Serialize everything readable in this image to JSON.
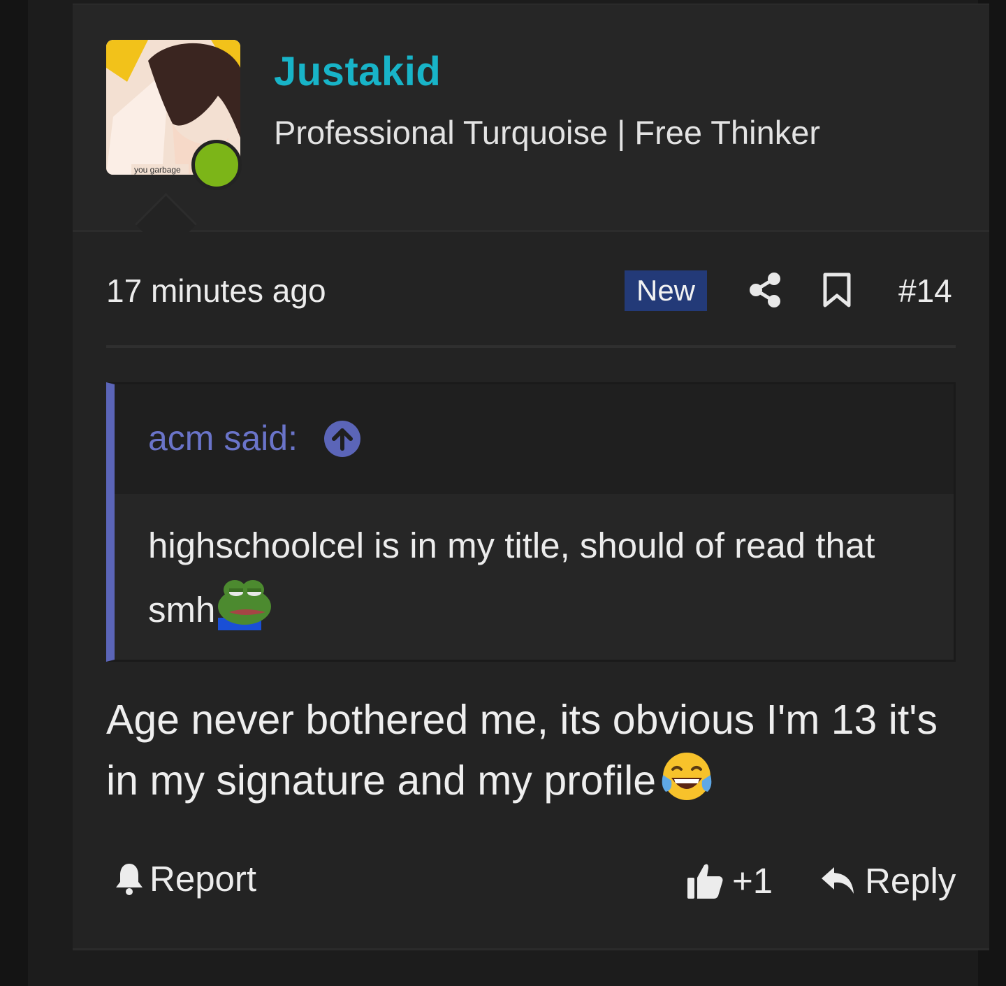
{
  "user": {
    "name": "Justakid",
    "title": "Professional Turquoise | Free Thinker",
    "avatar_caption": "you garbage",
    "online": true
  },
  "meta": {
    "time": "17 minutes ago",
    "badge": "New",
    "post_number": "#14",
    "share_icon": "share-icon",
    "bookmark_icon": "bookmark-icon"
  },
  "quote": {
    "author": "acm said:",
    "text": "highschoolcel is in my title, should of read that smh",
    "emoji": "pepe-sad-emoji"
  },
  "message": {
    "text": "Age never bothered me, its obvious I'm 13 it's in my signature and my profile",
    "emoji": "laughing-crying-emoji"
  },
  "actions": {
    "report": "Report",
    "like": "+1",
    "reply": "Reply"
  },
  "colors": {
    "username": "#18b4c8",
    "badge_bg": "#233a78",
    "quote_accent": "#5b65b8",
    "online_dot": "#7cb518"
  }
}
